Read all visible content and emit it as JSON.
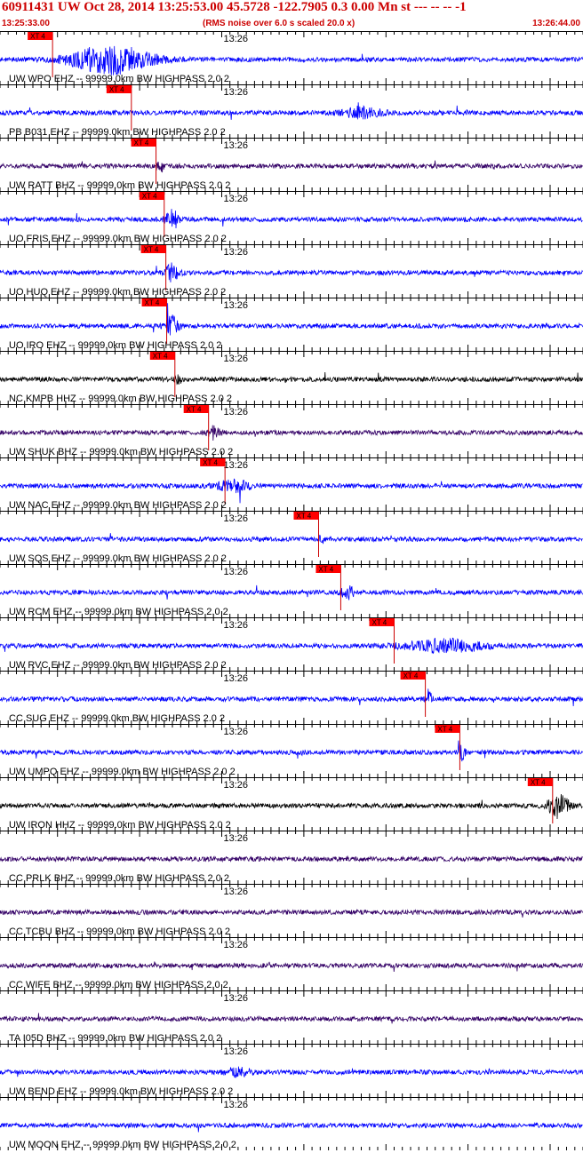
{
  "header": {
    "title": "60911431 UW Oct 28, 2014 13:25:53.00   45.5728 -122.7905  0.3 0.00 Mn st --- -- --  -1",
    "start_time": "13:25:33.00",
    "rms_note": "(RMS noise over 6.0 s scaled 20.0 x)",
    "end_time": "13:26:44.00"
  },
  "colors": {
    "header": "#cc0000",
    "pick_box": "#ff0000",
    "pick_line": "#cc0000",
    "tick": "#000000",
    "label": "#000000"
  },
  "chart_data": {
    "type": "line",
    "title": "60911431 UW Oct 28, 2014 13:25:53.00   45.5728 -122.7905  0.3 0.00 Mn st --- -- --  -1",
    "xlabel": "",
    "ylabel": "",
    "x_range": [
      "13:25:33.00",
      "13:26:44.00"
    ],
    "minute_label": "13:26",
    "pick_label": "XT 4",
    "grid": false,
    "series": [
      {
        "label": "UW WPO EHZ -- 99999.0km BW  HIGHPASS  2.0  2",
        "color": "#0000ff",
        "pick_time_s": 6.4,
        "burst": {
          "center_s": 13.5,
          "width_s": 12,
          "strength": 6
        }
      },
      {
        "label": "PB B031 EHZ -- 99999.0km BW  HIGHPASS  2.0  2",
        "color": "#0000ff",
        "pick_time_s": 16.0,
        "burst": {
          "center_s": 44.0,
          "width_s": 6,
          "strength": 2.2
        }
      },
      {
        "label": "UW RATT BHZ -- 99999.0km BW  HIGHPASS  2.0  2",
        "color": "#330066",
        "pick_time_s": 19.0,
        "burst": {
          "center_s": 19.5,
          "width_s": 1,
          "strength": 3
        }
      },
      {
        "label": "UO FRIS EHZ -- 99999.0km BW  HIGHPASS  2.0  2",
        "color": "#0000ff",
        "pick_time_s": 20.0,
        "burst": {
          "center_s": 21.0,
          "width_s": 2,
          "strength": 4
        }
      },
      {
        "label": "UO HUQ EHZ -- 99999.0km BW  HIGHPASS  2.0  2",
        "color": "#0000ff",
        "pick_time_s": 20.2,
        "burst": {
          "center_s": 21.0,
          "width_s": 2,
          "strength": 4
        }
      },
      {
        "label": "UO IRO EHZ -- 99999.0km BW  HIGHPASS  2.0  2",
        "color": "#0000ff",
        "pick_time_s": 20.3,
        "burst": {
          "center_s": 21.0,
          "width_s": 2,
          "strength": 4
        }
      },
      {
        "label": "NC KMPB HHZ -- 99999.0km BW  HIGHPASS  2.0  2",
        "color": "#000000",
        "pick_time_s": 21.3,
        "burst": {
          "center_s": 21.7,
          "width_s": 1,
          "strength": 2
        }
      },
      {
        "label": "UW SHUK BHZ -- 99999.0km BW  HIGHPASS  2.0  2",
        "color": "#330066",
        "pick_time_s": 25.4,
        "burst": {
          "center_s": 26.0,
          "width_s": 2,
          "strength": 2.5
        }
      },
      {
        "label": "UW NAC EHZ -- 99999.0km BW  HIGHPASS  2.0  2",
        "color": "#0000ff",
        "pick_time_s": 27.4,
        "burst": {
          "center_s": 28.5,
          "width_s": 5,
          "strength": 2.2
        }
      },
      {
        "label": "UW SQS EHZ -- 99999.0km BW  HIGHPASS  2.0  2",
        "color": "#0000ff",
        "pick_time_s": 38.8,
        "burst": {
          "center_s": 39.2,
          "width_s": 1,
          "strength": 1.6
        }
      },
      {
        "label": "UW RCM EHZ -- 99999.0km BW  HIGHPASS  2.0  2",
        "color": "#0000ff",
        "pick_time_s": 41.5,
        "burst": {
          "center_s": 42.3,
          "width_s": 2,
          "strength": 2.5
        }
      },
      {
        "label": "UW RVC EHZ -- 99999.0km BW  HIGHPASS  2.0  2",
        "color": "#0000ff",
        "pick_time_s": 48.0,
        "burst": {
          "center_s": 54.0,
          "width_s": 12,
          "strength": 2.6
        }
      },
      {
        "label": "CC SUG EHZ -- 99999.0km BW  HIGHPASS  2.0  2",
        "color": "#0000ff",
        "pick_time_s": 51.8,
        "burst": {
          "center_s": 52.3,
          "width_s": 1,
          "strength": 2.5
        }
      },
      {
        "label": "UW UMPQ EHZ -- 99999.0km BW  HIGHPASS  2.0  2",
        "color": "#0000ff",
        "pick_time_s": 56.0,
        "burst": {
          "center_s": 56.3,
          "width_s": 1,
          "strength": 3
        }
      },
      {
        "label": "UW IRON HHZ -- 99999.0km BW  HIGHPASS  2.0  2",
        "color": "#000000",
        "pick_time_s": 67.3,
        "burst": {
          "center_s": 68.0,
          "width_s": 3,
          "strength": 5
        }
      },
      {
        "label": "CC PRLK BHZ -- 99999.0km BW  HIGHPASS  2.0  2",
        "color": "#330066",
        "pick_time_s": null,
        "burst": null
      },
      {
        "label": "CC TCBU BHZ -- 99999.0km BW  HIGHPASS  2.0  2",
        "color": "#330066",
        "pick_time_s": null,
        "burst": null
      },
      {
        "label": "CC WIFE BHZ -- 99999.0km BW  HIGHPASS  2.0  2",
        "color": "#330066",
        "pick_time_s": null,
        "burst": null
      },
      {
        "label": "TA I05D BHZ -- 99999.0km BW  HIGHPASS  2.0  2",
        "color": "#330066",
        "pick_time_s": null,
        "burst": null
      },
      {
        "label": "UW BEND EHZ -- 99999.0km BW  HIGHPASS  2.0  2",
        "color": "#0000ff",
        "pick_time_s": null,
        "burst": {
          "center_s": 29.0,
          "width_s": 4,
          "strength": 1.6
        }
      },
      {
        "label": "UW MOON EHZ -- 99999.0km BW  HIGHPASS  2.0  2",
        "color": "#0000ff",
        "pick_time_s": null,
        "burst": null
      }
    ]
  }
}
